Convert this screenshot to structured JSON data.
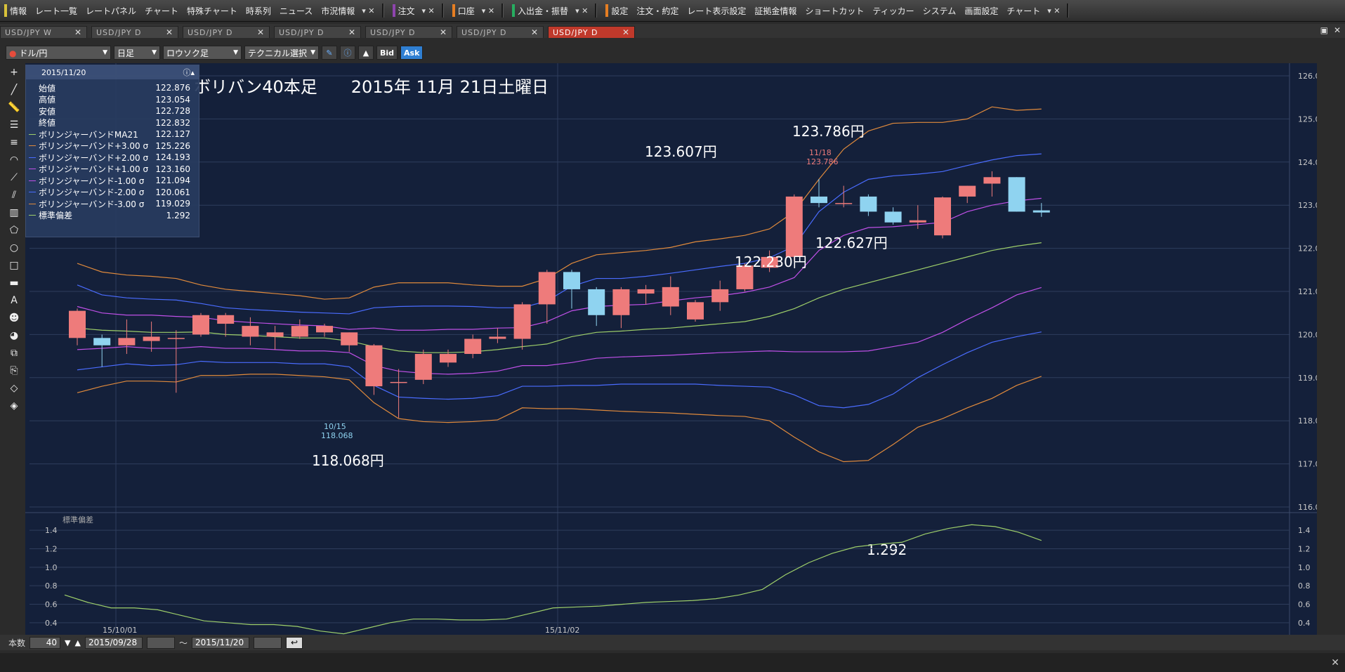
{
  "menu": {
    "items": [
      {
        "label": "情報",
        "accent": "#d9c23a"
      },
      {
        "label": "レート一覧"
      },
      {
        "label": "レートパネル"
      },
      {
        "label": "チャート"
      },
      {
        "label": "特殊チャート"
      },
      {
        "label": "時系列"
      },
      {
        "label": "ニュース"
      },
      {
        "label": "市況情報"
      }
    ],
    "group2": [
      {
        "label": "注文",
        "accent": "#8e44ad"
      }
    ],
    "group3": [
      {
        "label": "口座",
        "accent": "#e67e22"
      }
    ],
    "group4": [
      {
        "label": "入出金・振替",
        "accent": "#27ae60"
      }
    ],
    "group5": [
      {
        "label": "設定",
        "accent": "#e67e22"
      },
      {
        "label": "注文・約定"
      },
      {
        "label": "レート表示設定"
      },
      {
        "label": "証拠金情報"
      },
      {
        "label": "ショートカット"
      },
      {
        "label": "ティッカー"
      },
      {
        "label": "システム"
      },
      {
        "label": "画面設定"
      },
      {
        "label": "チャート"
      }
    ]
  },
  "tabs": [
    {
      "label": "USD/JPY W",
      "active": false
    },
    {
      "label": "USD/JPY D",
      "active": false
    },
    {
      "label": "USD/JPY D",
      "active": false
    },
    {
      "label": "USD/JPY D",
      "active": false
    },
    {
      "label": "USD/JPY D",
      "active": false
    },
    {
      "label": "USD/JPY D",
      "active": false
    },
    {
      "label": "USD/JPY D",
      "active": true
    }
  ],
  "toolbar": {
    "pair": "ドル/円",
    "timeframe": "日足",
    "chart_style": "ロウソク足",
    "technical": "テクニカル選択",
    "bid": "Bid",
    "ask": "Ask"
  },
  "left_tools": [
    "plus-icon",
    "line-icon",
    "ruler-icon",
    "hlines-icon",
    "vlines-icon",
    "fib-fan-icon",
    "fib-arc-icon",
    "channel-icon",
    "grid-icon",
    "pentagon-icon",
    "circle-icon",
    "rect-icon",
    "hline-icon",
    "text-icon",
    "face-icon",
    "paint-icon",
    "copy-icon",
    "paste-icon",
    "eraser-icon",
    "eraser2-icon"
  ],
  "info_panel": {
    "date": "2015/11/20",
    "rows": [
      {
        "label": "始値",
        "value": "122.876",
        "color": ""
      },
      {
        "label": "高値",
        "value": "123.054",
        "color": ""
      },
      {
        "label": "安値",
        "value": "122.728",
        "color": ""
      },
      {
        "label": "終値",
        "value": "122.832",
        "color": ""
      },
      {
        "label": "ボリンジャーバンドMA21",
        "value": "122.127",
        "color": "#9ecf6a"
      },
      {
        "label": "ボリンジャーバンド+3.00 σ",
        "value": "125.226",
        "color": "#e08a3c"
      },
      {
        "label": "ボリンジャーバンド+2.00 σ",
        "value": "124.193",
        "color": "#4a6cff"
      },
      {
        "label": "ボリンジャーバンド+1.00 σ",
        "value": "123.160",
        "color": "#c050e8"
      },
      {
        "label": "ボリンジャーバンド-1.00 σ",
        "value": "121.094",
        "color": "#c050e8"
      },
      {
        "label": "ボリンジャーバンド-2.00 σ",
        "value": "120.061",
        "color": "#4a6cff"
      },
      {
        "label": "ボリンジャーバンド-3.00 σ",
        "value": "119.029",
        "color": "#e08a3c"
      },
      {
        "label": "標準偏差",
        "value": "1.292",
        "color": "#9ecf6a"
      }
    ]
  },
  "annotations": {
    "title": "ボリバン40本足　　2015年 11月  21日土曜日",
    "label_123607": "123.607円",
    "label_123786": "123.786円",
    "label_122230": "122.230円",
    "label_122627": "122.627円",
    "label_118068": "118.068円",
    "label_1292": "1.292",
    "marker_high_date": "11/18",
    "marker_high_val": "123.786",
    "marker_low_date": "10/15",
    "marker_low_val": "118.068"
  },
  "chart_data": {
    "type": "candlestick",
    "price_axis": {
      "min": 116,
      "max": 126,
      "ticks": [
        "126.00",
        "125.00",
        "124.00",
        "123.00",
        "122.00",
        "121.00",
        "120.00",
        "119.00",
        "118.00",
        "117.00",
        "116.00"
      ]
    },
    "x_labels": [
      "15/10/01",
      "15/11/02"
    ],
    "candles": [
      {
        "o": 119.92,
        "h": 120.6,
        "l": 119.75,
        "c": 120.55
      },
      {
        "o": 119.92,
        "h": 120.0,
        "l": 119.25,
        "c": 119.75
      },
      {
        "o": 119.75,
        "h": 120.35,
        "l": 119.55,
        "c": 119.92
      },
      {
        "o": 119.85,
        "h": 120.3,
        "l": 119.6,
        "c": 119.95
      },
      {
        "o": 119.9,
        "h": 120.1,
        "l": 118.65,
        "c": 119.92
      },
      {
        "o": 120.0,
        "h": 120.5,
        "l": 119.95,
        "c": 120.45
      },
      {
        "o": 120.25,
        "h": 120.5,
        "l": 119.95,
        "c": 120.45
      },
      {
        "o": 119.95,
        "h": 120.4,
        "l": 119.75,
        "c": 120.2
      },
      {
        "o": 119.95,
        "h": 120.2,
        "l": 119.65,
        "c": 120.05
      },
      {
        "o": 119.95,
        "h": 120.35,
        "l": 119.9,
        "c": 120.2
      },
      {
        "o": 120.05,
        "h": 120.25,
        "l": 119.95,
        "c": 120.2
      },
      {
        "o": 119.75,
        "h": 120.05,
        "l": 119.6,
        "c": 120.05
      },
      {
        "o": 118.8,
        "h": 119.78,
        "l": 118.6,
        "c": 119.75
      },
      {
        "o": 118.9,
        "h": 119.2,
        "l": 118.068,
        "c": 118.9
      },
      {
        "o": 118.95,
        "h": 119.65,
        "l": 118.85,
        "c": 119.55
      },
      {
        "o": 119.35,
        "h": 119.65,
        "l": 119.25,
        "c": 119.55
      },
      {
        "o": 119.55,
        "h": 120.0,
        "l": 119.45,
        "c": 119.9
      },
      {
        "o": 119.9,
        "h": 120.15,
        "l": 119.8,
        "c": 119.95
      },
      {
        "o": 119.9,
        "h": 120.75,
        "l": 119.65,
        "c": 120.7
      },
      {
        "o": 120.7,
        "h": 121.5,
        "l": 120.25,
        "c": 121.45
      },
      {
        "o": 121.45,
        "h": 121.5,
        "l": 120.6,
        "c": 121.05
      },
      {
        "o": 121.05,
        "h": 121.1,
        "l": 120.2,
        "c": 120.45
      },
      {
        "o": 120.45,
        "h": 121.1,
        "l": 120.15,
        "c": 121.05
      },
      {
        "o": 120.95,
        "h": 121.15,
        "l": 120.7,
        "c": 121.05
      },
      {
        "o": 120.65,
        "h": 121.35,
        "l": 120.45,
        "c": 121.1
      },
      {
        "o": 120.35,
        "h": 120.8,
        "l": 120.3,
        "c": 120.75
      },
      {
        "o": 120.75,
        "h": 121.25,
        "l": 120.55,
        "c": 121.05
      },
      {
        "o": 121.05,
        "h": 121.65,
        "l": 121.0,
        "c": 121.6
      },
      {
        "o": 121.55,
        "h": 121.95,
        "l": 121.45,
        "c": 121.8
      },
      {
        "o": 121.8,
        "h": 123.25,
        "l": 121.7,
        "c": 123.2
      },
      {
        "o": 123.2,
        "h": 123.607,
        "l": 122.95,
        "c": 123.05
      },
      {
        "o": 123.05,
        "h": 123.45,
        "l": 122.95,
        "c": 123.05
      },
      {
        "o": 123.2,
        "h": 123.25,
        "l": 122.75,
        "c": 122.85
      },
      {
        "o": 122.85,
        "h": 122.95,
        "l": 122.55,
        "c": 122.6
      },
      {
        "o": 122.6,
        "h": 123.0,
        "l": 122.45,
        "c": 122.65
      },
      {
        "o": 122.3,
        "h": 123.2,
        "l": 122.23,
        "c": 123.18
      },
      {
        "o": 123.2,
        "h": 123.45,
        "l": 123.05,
        "c": 123.45
      },
      {
        "o": 123.5,
        "h": 123.786,
        "l": 123.2,
        "c": 123.65
      },
      {
        "o": 123.65,
        "h": 123.65,
        "l": 122.85,
        "c": 122.85
      },
      {
        "o": 122.88,
        "h": 123.05,
        "l": 122.73,
        "c": 122.83
      }
    ],
    "bands": [
      {
        "name": "+3σ",
        "color": "#e08a3c",
        "values": [
          121.65,
          121.45,
          121.38,
          121.35,
          121.3,
          121.15,
          121.05,
          121.0,
          120.95,
          120.9,
          120.82,
          120.85,
          121.1,
          121.2,
          121.2,
          121.2,
          121.15,
          121.12,
          121.12,
          121.3,
          121.65,
          121.85,
          121.9,
          121.95,
          122.02,
          122.15,
          122.22,
          122.3,
          122.45,
          122.85,
          123.6,
          124.3,
          124.72,
          124.9,
          124.92,
          124.92,
          125.0,
          125.28,
          125.2,
          125.23
        ]
      },
      {
        "name": "+2σ",
        "color": "#4a6cff",
        "values": [
          121.15,
          120.92,
          120.85,
          120.82,
          120.8,
          120.72,
          120.62,
          120.58,
          120.55,
          120.52,
          120.5,
          120.48,
          120.62,
          120.65,
          120.66,
          120.66,
          120.65,
          120.62,
          120.62,
          120.78,
          121.12,
          121.3,
          121.3,
          121.35,
          121.42,
          121.5,
          121.58,
          121.65,
          121.78,
          122.05,
          122.85,
          123.3,
          123.6,
          123.68,
          123.72,
          123.78,
          123.92,
          124.05,
          124.15,
          124.19
        ]
      },
      {
        "name": "+1σ",
        "color": "#c050e8",
        "values": [
          120.65,
          120.5,
          120.45,
          120.45,
          120.42,
          120.4,
          120.32,
          120.28,
          120.25,
          120.22,
          120.2,
          120.12,
          120.15,
          120.1,
          120.1,
          120.12,
          120.12,
          120.15,
          120.16,
          120.3,
          120.55,
          120.65,
          120.68,
          120.7,
          120.78,
          120.85,
          120.9,
          120.98,
          121.1,
          121.32,
          121.95,
          122.3,
          122.48,
          122.5,
          122.55,
          122.6,
          122.85,
          123.0,
          123.1,
          123.16
        ]
      },
      {
        "name": "MA21",
        "color": "#9ecf6a",
        "values": [
          120.15,
          120.1,
          120.08,
          120.05,
          120.05,
          120.06,
          120.0,
          119.98,
          119.95,
          119.92,
          119.92,
          119.85,
          119.72,
          119.62,
          119.58,
          119.58,
          119.6,
          119.65,
          119.72,
          119.78,
          119.95,
          120.05,
          120.08,
          120.12,
          120.15,
          120.2,
          120.25,
          120.3,
          120.42,
          120.6,
          120.85,
          121.05,
          121.2,
          121.35,
          121.5,
          121.65,
          121.8,
          121.95,
          122.05,
          122.13
        ]
      },
      {
        "name": "-1σ",
        "color": "#c050e8",
        "values": [
          119.65,
          119.68,
          119.72,
          119.68,
          119.68,
          119.72,
          119.68,
          119.68,
          119.65,
          119.62,
          119.62,
          119.58,
          119.28,
          119.15,
          119.1,
          119.08,
          119.1,
          119.15,
          119.28,
          119.28,
          119.35,
          119.45,
          119.48,
          119.5,
          119.52,
          119.55,
          119.58,
          119.6,
          119.62,
          119.6,
          119.6,
          119.6,
          119.62,
          119.72,
          119.82,
          120.05,
          120.35,
          120.62,
          120.92,
          121.09
        ]
      },
      {
        "name": "-2σ",
        "color": "#4a6cff",
        "values": [
          119.18,
          119.25,
          119.32,
          119.28,
          119.3,
          119.38,
          119.35,
          119.35,
          119.35,
          119.32,
          119.32,
          119.25,
          118.82,
          118.55,
          118.52,
          118.5,
          118.52,
          118.58,
          118.8,
          118.8,
          118.82,
          118.82,
          118.85,
          118.85,
          118.85,
          118.85,
          118.82,
          118.8,
          118.78,
          118.6,
          118.35,
          118.3,
          118.38,
          118.62,
          119.0,
          119.3,
          119.58,
          119.82,
          119.95,
          120.06
        ]
      },
      {
        "name": "-3σ",
        "color": "#e08a3c",
        "values": [
          118.65,
          118.8,
          118.92,
          118.92,
          118.9,
          119.05,
          119.05,
          119.08,
          119.08,
          119.05,
          119.02,
          118.95,
          118.42,
          118.05,
          117.98,
          117.96,
          117.98,
          118.02,
          118.3,
          118.28,
          118.28,
          118.25,
          118.22,
          118.2,
          118.18,
          118.15,
          118.12,
          118.1,
          118.0,
          117.62,
          117.28,
          117.05,
          117.08,
          117.45,
          117.85,
          118.05,
          118.3,
          118.52,
          118.82,
          119.03
        ]
      }
    ],
    "stddev": {
      "axis": {
        "ticks": [
          "1.4",
          "1.2",
          "1.0",
          "0.8",
          "0.6",
          "0.4"
        ]
      },
      "label": "標準偏差",
      "color": "#9ecf6a",
      "values": [
        0.7,
        0.62,
        0.56,
        0.56,
        0.54,
        0.48,
        0.42,
        0.4,
        0.38,
        0.38,
        0.36,
        0.31,
        0.28,
        0.34,
        0.4,
        0.44,
        0.44,
        0.43,
        0.43,
        0.44,
        0.5,
        0.56,
        0.57,
        0.58,
        0.6,
        0.62,
        0.63,
        0.64,
        0.66,
        0.7,
        0.76,
        0.92,
        1.05,
        1.15,
        1.22,
        1.25,
        1.27,
        1.36,
        1.42,
        1.46,
        1.44,
        1.38,
        1.29
      ]
    }
  },
  "bottom": {
    "count_label": "本数",
    "count": "40",
    "start_date": "2015/09/28",
    "tilde": "〜",
    "end_date": "2015/11/20"
  },
  "status": {
    "text": "",
    "close": "✕"
  }
}
